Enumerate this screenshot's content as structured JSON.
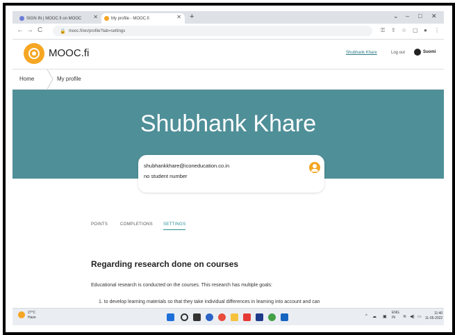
{
  "browser": {
    "tabs": [
      {
        "label": "SIGN IN | MOOC.fi on MOOC",
        "favicon_color": "#6b7bd6"
      },
      {
        "label": "My profile - MOOC.fi",
        "favicon_color": "#f5a623"
      }
    ],
    "new_tab": "+",
    "window_controls": [
      "⌄",
      "–",
      "□",
      "✕"
    ],
    "url": "mooc.fi/en/profile?tab=settings",
    "nav": {
      "back": "←",
      "forward": "→",
      "reload": "C"
    }
  },
  "site": {
    "brand": "MOOC.fi",
    "header_links": {
      "user": "Shubhank Khare",
      "logout": "Log out",
      "language": "Suomi"
    }
  },
  "breadcrumb": [
    "Home",
    "My profile"
  ],
  "profile": {
    "name": "Shubhank Khare",
    "email": "shubhankkhare@iconeducation.co.in",
    "student_number": "no student number"
  },
  "tabs": [
    {
      "label": "POINTS",
      "active": false
    },
    {
      "label": "COMPLETIONS",
      "active": false
    },
    {
      "label": "SETTINGS",
      "active": true
    }
  ],
  "content": {
    "heading": "Regarding research done on courses",
    "paragraph": "Educational research is conducted on the courses. This research has multiple goals:",
    "list_item": "1. to develop learning materials so that they take individual differences in learning into account and can"
  },
  "taskbar": {
    "weather_temp": "27°C",
    "weather_desc": "Haze",
    "lang": "ENG",
    "lang_sub": "IN",
    "time": "11:40",
    "date": "11-05-2022"
  },
  "colors": {
    "banner": "#4f8f98",
    "accent": "#2a8f95",
    "brand_orange": "#f5a623"
  }
}
